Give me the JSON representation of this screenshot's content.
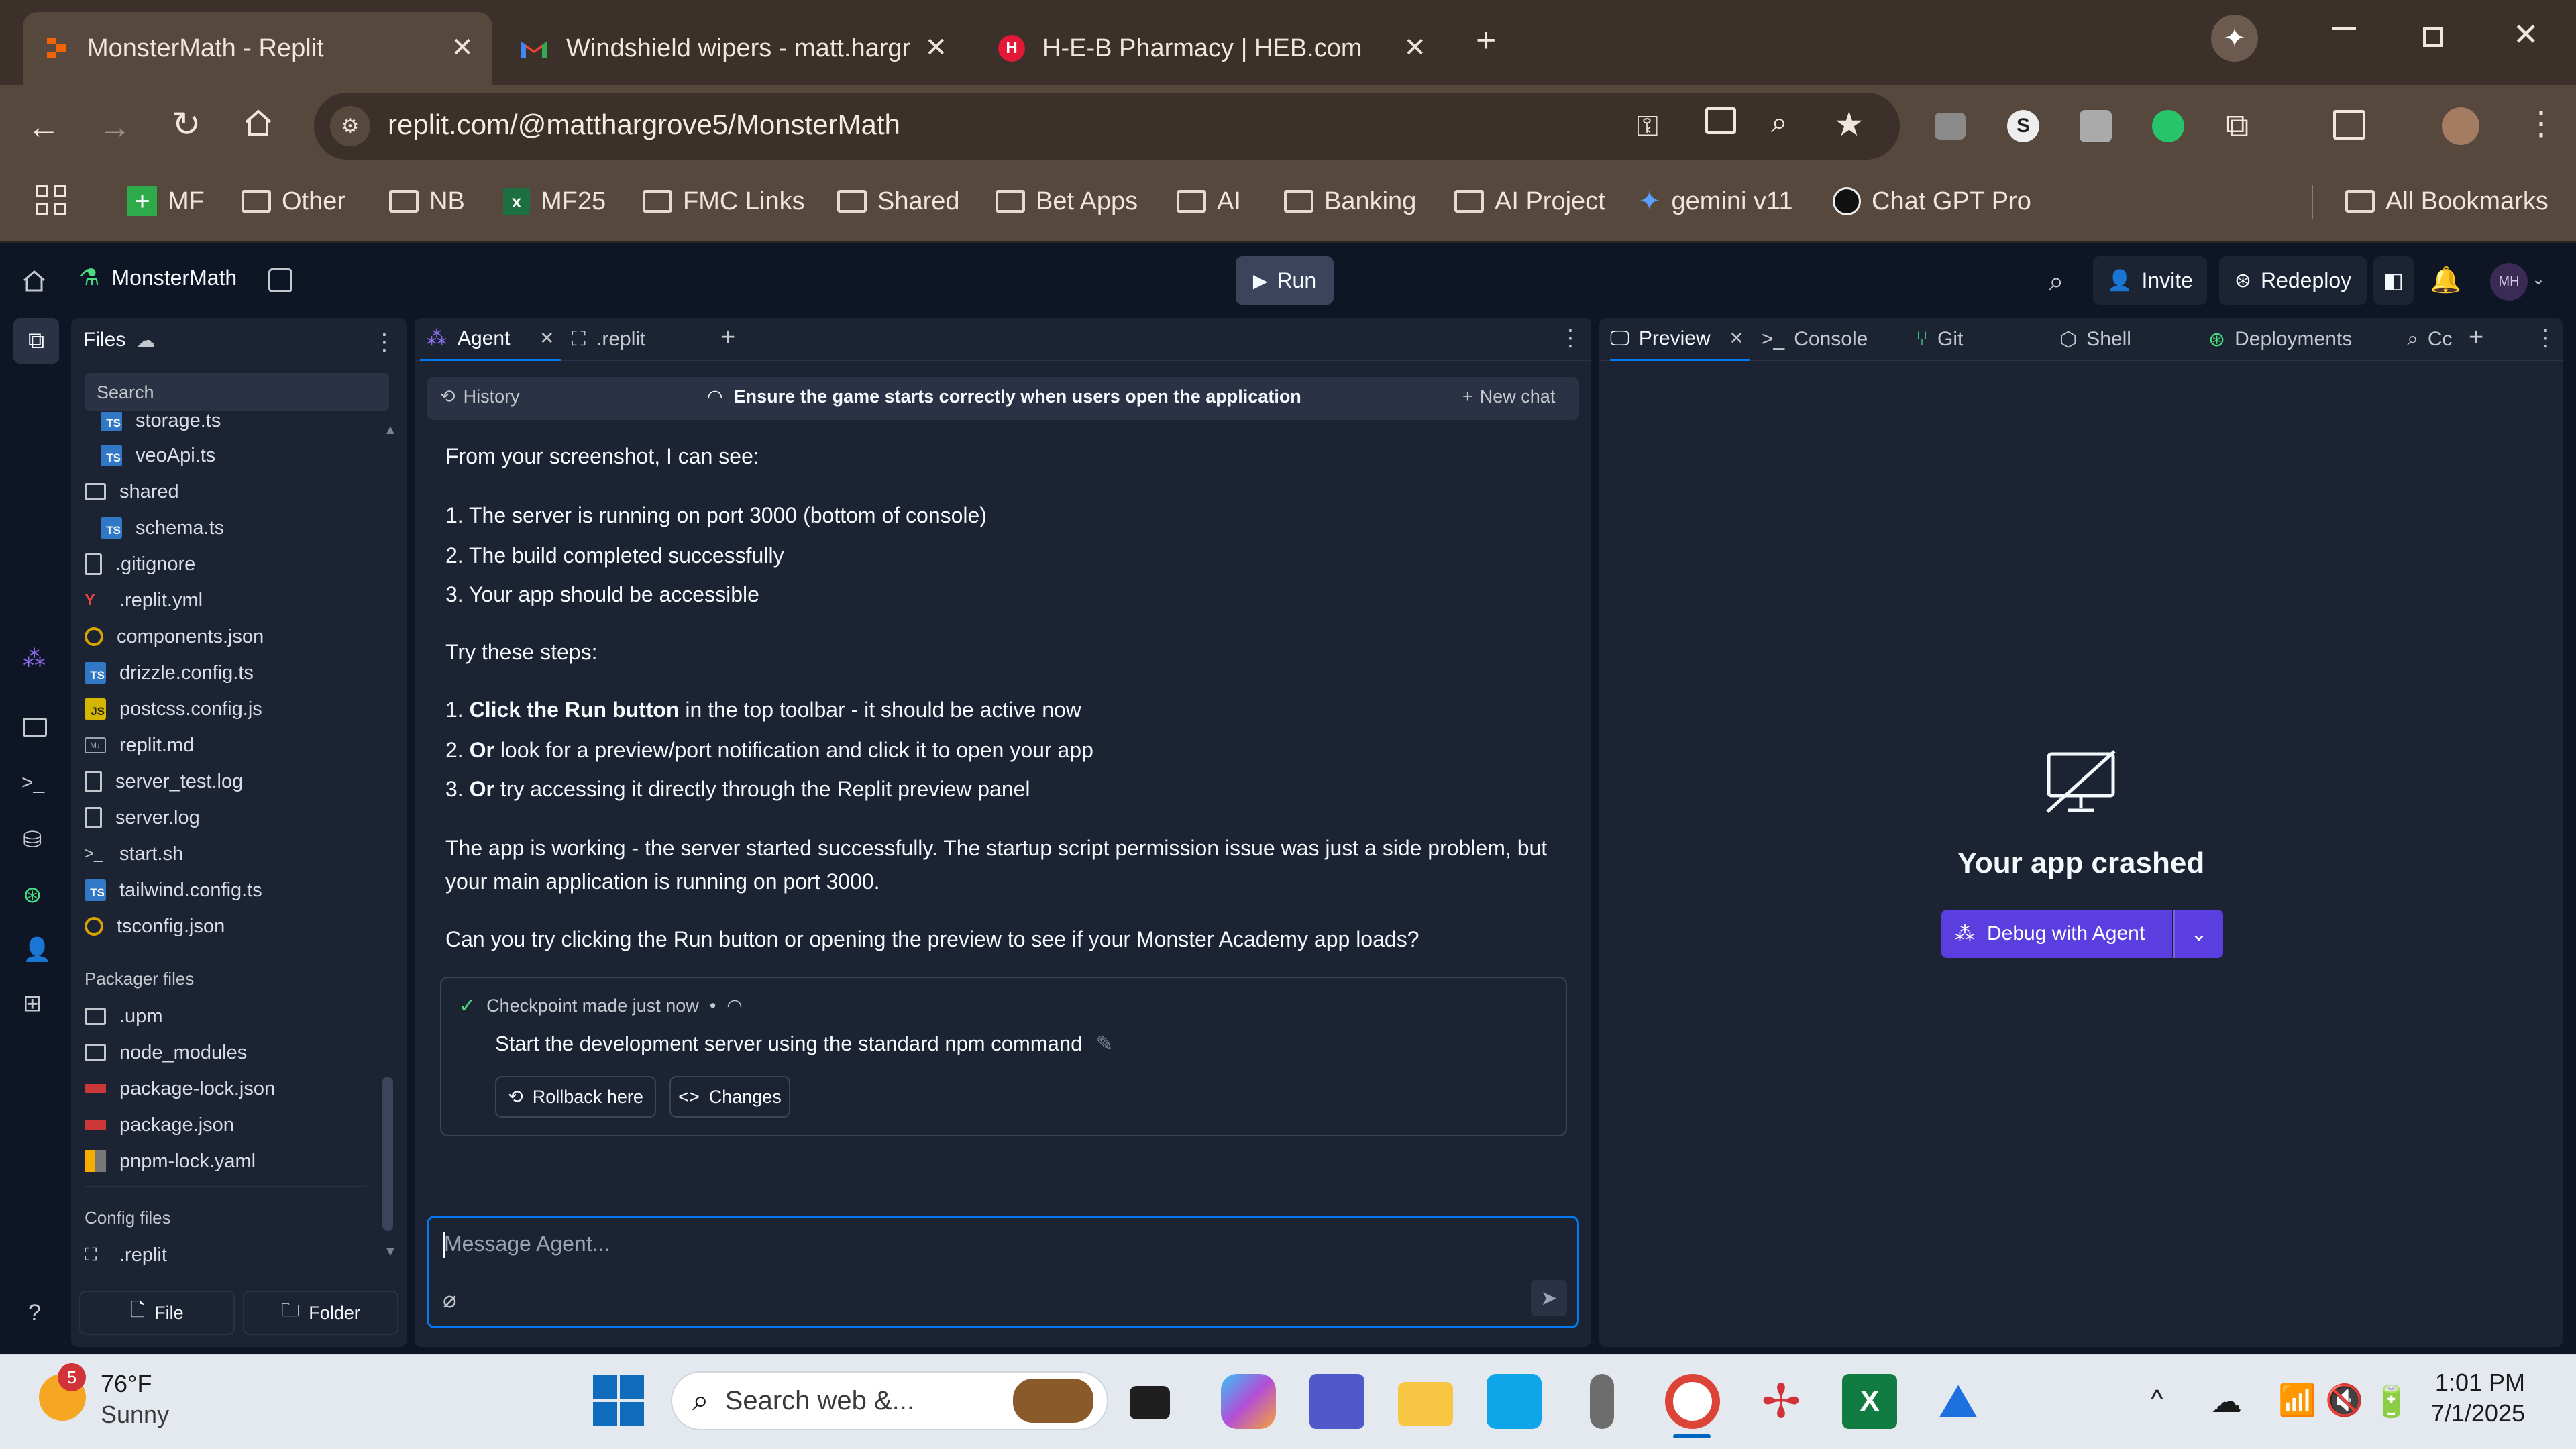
{
  "browser": {
    "tabs": [
      {
        "title": "MonsterMath - Replit",
        "icon": "replit-icon",
        "active": true
      },
      {
        "title": "Windshield wipers - matt.hargr",
        "icon": "gmail-icon",
        "active": false
      },
      {
        "title": "H-E-B Pharmacy | HEB.com",
        "icon": "heb-icon",
        "active": false
      }
    ],
    "url": "replit.com/@matthargrove5/MonsterMath",
    "bookmarks": [
      "MF",
      "Other",
      "NB",
      "MF25",
      "FMC Links",
      "Shared",
      "Bet Apps",
      "AI",
      "Banking",
      "AI Project",
      "gemini v11",
      "Chat GPT Pro"
    ],
    "all_bookmarks": "All Bookmarks"
  },
  "replit": {
    "project": "MonsterMath",
    "run_label": "Run",
    "invite_label": "Invite",
    "redeploy_label": "Redeploy",
    "avatar_initials": "MH",
    "files": {
      "header": "Files",
      "search_placeholder": "Search",
      "items": [
        "storage.ts",
        "veoApi.ts",
        "shared",
        "schema.ts",
        ".gitignore",
        ".replit.yml",
        "components.json",
        "drizzle.config.ts",
        "postcss.config.js",
        "replit.md",
        "server_test.log",
        "server.log",
        "start.sh",
        "tailwind.config.ts",
        "tsconfig.json"
      ],
      "packager_header": "Packager files",
      "packager_items": [
        ".upm",
        "node_modules",
        "package-lock.json",
        "package.json",
        "pnpm-lock.yaml"
      ],
      "config_header": "Config files",
      "config_items": [
        ".replit"
      ],
      "new_file": "File",
      "new_folder": "Folder"
    },
    "agent": {
      "tabs": [
        "Agent",
        ".replit"
      ],
      "history": "History",
      "chat_title": "Ensure the game starts correctly when users open the application",
      "new_chat": "New chat",
      "lines": {
        "intro": "From your screenshot, I can see:",
        "see1": "1. The server is running on port 3000 (bottom of console)",
        "see2": "2. The build completed successfully",
        "see3": "3. Your app should be accessible",
        "try": "Try these steps:",
        "step1_num": "1.",
        "step1_bold": "Click the Run button",
        "step1_rest": "in the top toolbar - it should be active now",
        "step2_num": "2.",
        "step2_bold": "Or",
        "step2_rest": "look for a preview/port notification and click it to open your app",
        "step3_num": "3.",
        "step3_bold": "Or",
        "step3_rest": "try accessing it directly through the Replit preview panel",
        "para1": "The app is working - the server started successfully. The startup script permission issue was just a side problem, but",
        "para2": "your main application is running on port 3000.",
        "question": "Can you try clicking the Run button or opening the preview to see if your Monster Academy app loads?"
      },
      "checkpoint": {
        "title": "Checkpoint made just now",
        "dot": "•",
        "description": "Start the development server using the standard npm command",
        "rollback": "Rollback here",
        "changes": "Changes"
      },
      "input_placeholder": "Message Agent..."
    },
    "preview": {
      "tabs": [
        "Preview",
        "Console",
        "Git",
        "Shell",
        "Deployments",
        "Cc"
      ],
      "crashed": "Your app crashed",
      "debug_button": "Debug with Agent"
    }
  },
  "taskbar": {
    "weather_temp": "76°F",
    "weather_desc": "Sunny",
    "weather_badge": "5",
    "search_placeholder": "Search web &...",
    "time": "1:01 PM",
    "date": "7/1/2025"
  }
}
